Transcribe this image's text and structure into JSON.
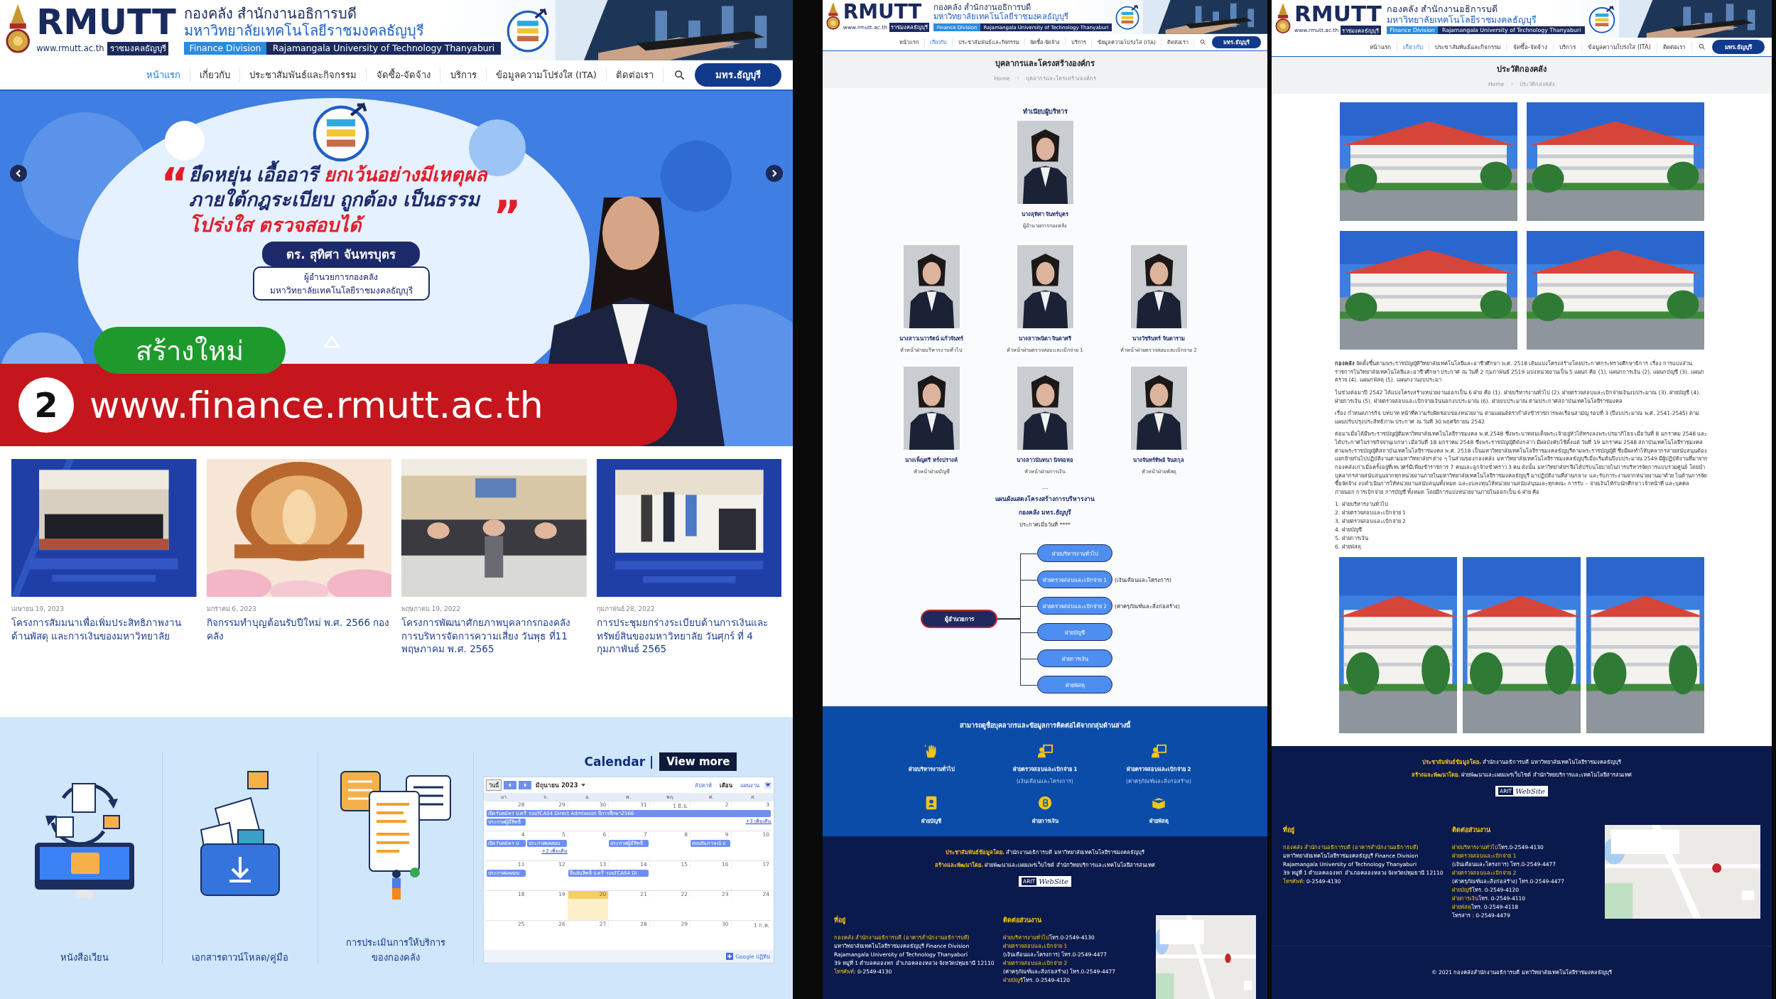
{
  "panels": [
    {
      "kind": "home",
      "header": {
        "logo_text": "RMUTT",
        "url": "www.rmutt.ac.th",
        "tag": "ราชมงคลธัญบุรี",
        "title1": "กองคลัง สำนักงานอธิการบดี",
        "title2": "มหาวิทยาลัยเทคโนโลยีราชมงคลธัญบุรี",
        "division": "Finance Division",
        "university": "Rajamangala University of Technology Thanyaburi"
      },
      "nav": [
        {
          "label": "หน้าแรก",
          "selected": true
        },
        {
          "label": "เกี่ยวกับ",
          "selected": false
        },
        {
          "label": "ประชาสัมพันธ์และกิจกรรม",
          "selected": false
        },
        {
          "label": "จัดซื้อ-จัดจ้าง",
          "selected": false
        },
        {
          "label": "บริการ",
          "selected": false
        },
        {
          "label": "ข้อมูลความโปร่งใส (ITA)",
          "selected": false
        },
        {
          "label": "ติดต่อเรา",
          "selected": false
        }
      ],
      "nav_button": "มทร.ธัญบุรี",
      "hero": {
        "quote_open": "“",
        "quote_close": "”",
        "lines": [
          {
            "parts": [
              {
                "text": "ยืดหยุ่น เอื้ออารี",
                "highlight": false
              },
              {
                "text": "ยกเว้นอย่างมีเหตุผล",
                "highlight": true
              }
            ]
          },
          {
            "parts": [
              {
                "text": "ภายใต้กฎระเบียบ ถูกต้อง เป็นธรรม",
                "highlight": false
              }
            ]
          },
          {
            "parts": [
              {
                "text": "โปร่งใส ตรวจสอบได้",
                "highlight": true
              }
            ]
          }
        ],
        "name": "ดร. สุทิศา จันทรบุตร",
        "role_lines": [
          "ผู้อำนวยการกองคลัง",
          "มหาวิทยาลัยเทคโนโลยีราชมงคลธัญบุรี"
        ]
      },
      "overlay": {
        "tag": "สร้างใหม่",
        "number": "2",
        "url": "www.finance.rmutt.ac.th"
      },
      "news": [
        {
          "date": "เมษายน 19, 2023",
          "title": "โครงการสัมมนาเพื่อเพิ่มประสิทธิภาพงานด้านพัสดุ และการเงินของมหาวิทยาลัย"
        },
        {
          "date": "มกราคม 6, 2023",
          "title": "กิจกรรมทำบุญต้อนรับปีใหม่ พ.ศ. 2566 กองคลัง"
        },
        {
          "date": "พฤษภาคม 19, 2022",
          "title": "โครงการพัฒนาศักยภาพบุคลากรกองคลัง การบริหารจัดการความเสี่ยง วันพุธ ที่11 พฤษภาคม พ.ศ. 2565"
        },
        {
          "date": "กุมภาพันธ์ 28, 2022",
          "title": "การประชุมยกร่างระเบียบด้านการเงินและทรัพย์สินของมหาวิทยาลัย วันศุกร์ ที่ 4 กุมภาพันธ์ 2565"
        }
      ],
      "services": [
        {
          "label": "หนังสือเวียน"
        },
        {
          "label": "เอกสารดาวน์โหลด/คู่มือ"
        },
        {
          "label": "การประเมินการให้บริการของกองคลัง"
        }
      ],
      "calendar": {
        "title": "Calendar |",
        "more": "View more",
        "today_button": "วันนี้",
        "month": "มิถุนายน 2023",
        "views": [
          {
            "label": "สัปดาห์",
            "selected": false
          },
          {
            "label": "เดือน",
            "selected": true
          },
          {
            "label": "แผนงาน",
            "selected": false
          }
        ],
        "weekdays": [
          "อา.",
          "จ.",
          "อ.",
          "พ.",
          "พฤ.",
          "ศ.",
          "ส."
        ],
        "weeks": [
          {
            "days": [
              {
                "label": "28",
                "selected": false,
                "events": [
                  {
                    "text": "เปิดรับสมัคร ป.ตรี รอบTCAS4 Direct Admission ปีการศึกษา2566",
                    "kind": "week"
                  },
                  {
                    "text": "ประกาศผู้มีสิทธิ์",
                    "kind": "single"
                  }
                ]
              },
              {
                "label": "29",
                "selected": false
              },
              {
                "label": "30",
                "selected": false
              },
              {
                "label": "31",
                "selected": false
              },
              {
                "label": "1 มิ.ย.",
                "selected": false
              },
              {
                "label": "2",
                "selected": false
              },
              {
                "label": "3",
                "selected": false,
                "events": [
                  {
                    "text": "+3 เพิ่มเติม",
                    "kind": "more"
                  }
                ]
              }
            ]
          },
          {
            "days": [
              {
                "label": "4",
                "selected": false,
                "events": [
                  {
                    "text": "เปิดรับสมัคร ป",
                    "kind": "single"
                  }
                ]
              },
              {
                "label": "5",
                "selected": false,
                "events": [
                  {
                    "text": "ประกาศผลสอบ",
                    "kind": "single"
                  },
                  {
                    "text": "+2 เพิ่มเติม",
                    "kind": "more"
                  }
                ]
              },
              {
                "label": "6",
                "selected": false
              },
              {
                "label": "7",
                "selected": false,
                "events": [
                  {
                    "text": "ประกาศผู้มีสิทธิ์",
                    "kind": "single"
                  }
                ]
              },
              {
                "label": "8",
                "selected": false
              },
              {
                "label": "9",
                "selected": false,
                "events": [
                  {
                    "text": "สอบสัมภาษณ์ ป",
                    "kind": "single"
                  }
                ]
              },
              {
                "label": "10",
                "selected": false
              }
            ]
          },
          {
            "days": [
              {
                "label": "11",
                "selected": false,
                "events": [
                  {
                    "text": "ประกาศผลสอบ",
                    "kind": "single"
                  }
                ]
              },
              {
                "label": "12",
                "selected": false
              },
              {
                "label": "13",
                "selected": false,
                "events": [
                  {
                    "text": "ยืนยันสิทธิ์ ป.ตรี รอบTCAS4 Di",
                    "kind": "double"
                  }
                ]
              },
              {
                "label": "14",
                "selected": false
              },
              {
                "label": "15",
                "selected": false
              },
              {
                "label": "16",
                "selected": false
              },
              {
                "label": "17",
                "selected": false
              }
            ]
          },
          {
            "days": [
              {
                "label": "18",
                "selected": false
              },
              {
                "label": "19",
                "selected": false
              },
              {
                "label": "20",
                "selected": true
              },
              {
                "label": "21",
                "selected": false
              },
              {
                "label": "22",
                "selected": false
              },
              {
                "label": "23",
                "selected": false
              },
              {
                "label": "24",
                "selected": false
              }
            ]
          },
          {
            "days": [
              {
                "label": "25",
                "selected": false
              },
              {
                "label": "26",
                "selected": false
              },
              {
                "label": "27",
                "selected": false
              },
              {
                "label": "28",
                "selected": false
              },
              {
                "label": "29",
                "selected": false
              },
              {
                "label": "30",
                "selected": false
              },
              {
                "label": "1 ก.ค.",
                "selected": false
              }
            ]
          }
        ],
        "footer": "Google ปฏิทิน"
      }
    },
    {
      "kind": "staff",
      "header": {
        "logo_text": "RMUTT",
        "url": "www.rmutt.ac.th",
        "tag": "ราชมงคลธัญบุรี",
        "title1": "กองคลัง สำนักงานอธิการบดี",
        "title2": "มหาวิทยาลัยเทคโนโลยีราชมงคลธัญบุรี",
        "division": "Finance Division",
        "university": "Rajamangala University of Technology Thanyaburi"
      },
      "nav": [
        {
          "label": "หน้าแรก",
          "selected": false
        },
        {
          "label": "เกี่ยวกับ",
          "selected": true
        },
        {
          "label": "ประชาสัมพันธ์และกิจกรรม",
          "selected": false
        },
        {
          "label": "จัดซื้อ-จัดจ้าง",
          "selected": false
        },
        {
          "label": "บริการ",
          "selected": false
        },
        {
          "label": "ข้อมูลความโปร่งใส (ITA)",
          "selected": false
        },
        {
          "label": "ติดต่อเรา",
          "selected": false
        }
      ],
      "nav_button": "มทร.ธัญบุรี",
      "page_title": "บุคลากรและโครงสร้างองค์กร",
      "breadcrumb": [
        "Home",
        "บุคลากรและโครงสร้างองค์กร"
      ],
      "section_title": "ทำเนียบผู้บริหาร",
      "director": {
        "name": "นางสุทิศา จันทร์บุตร",
        "role": "ผู้อำนวยการกองคลัง"
      },
      "staff": [
        {
          "name": "นางสาวเนาวรัตน์ แก้วจันทร์",
          "role": "หัวหน้าฝ่ายบริหารงานทั่วไป"
        },
        {
          "name": "นางสาวพนิดา จินดาศรี",
          "role": "หัวหน้าฝ่ายตรวจสอบและเบิกจ่าย 1"
        },
        {
          "name": "นางวัชรินทร์ จินดาราม",
          "role": "หัวหน้าฝ่ายตรวจสอบและเบิกจ่าย 2"
        },
        {
          "name": "นางเพ็ญศรี หรั่งปรางค์",
          "role": "หัวหน้าฝ่ายบัญชี"
        },
        {
          "name": "นางสาวนันทนา นิจจอหอ",
          "role": "หัวหน้าฝ่ายการเงิน"
        },
        {
          "name": "นางจันทร์ทิพย์ จินสกุล",
          "role": "หัวหน้าฝ่ายพัสดุ"
        }
      ],
      "ellipsis": "...",
      "chart_title": "แผนผังแสดงโครงสร้างการบริหารงาน",
      "chart_subtitle": "กองคลัง มทร.ธัญบุรี",
      "chart_date": "ประกาศเมื่อวันที่ ****",
      "org": {
        "root": "ผู้อำนวยการ",
        "children": [
          {
            "label": "ฝ่ายบริหารงานทั่วไป"
          },
          {
            "label": "ฝ่ายตรวจสอบและเบิกจ่าย 1",
            "note": "(เงินเดือนและโครงการ)"
          },
          {
            "label": "ฝ่ายตรวจสอบและเบิกจ่าย 2",
            "note": "(ค่าครุภัณฑ์และสิ่งก่อสร้าง)"
          },
          {
            "label": "ฝ่ายบัญชี"
          },
          {
            "label": "ฝ่ายการเงิน"
          },
          {
            "label": "ฝ่ายพัสดุ"
          }
        ]
      },
      "groups_title": "สามารถดูชื่อบุคลากรและข้อมูลการติดต่อได้จากกลุ่มด้านล่างนี้",
      "groups": [
        {
          "label": "ฝ่ายบริหารงานทั่วไป"
        },
        {
          "label": "ฝ่ายตรวจสอบและเบิกจ่าย 1",
          "sub": "(เงินเดือนและโครงการ)"
        },
        {
          "label": "ฝ่ายตรวจสอบและเบิกจ่าย 2",
          "sub": "(ค่าครุภัณฑ์และสิ่งก่อสร้าง)"
        },
        {
          "label": "ฝ่ายบัญชี"
        },
        {
          "label": "ฝ่ายการเงิน"
        },
        {
          "label": "ฝ่ายพัสดุ"
        }
      ],
      "footer": {
        "credits": [
          {
            "label": "ประชาสัมพันธ์ข้อมูลโดย.",
            "text": "สำนักงานอธิการบดี มหาวิทยาลัยเทคโนโลยีราชมงคลธัญบุรี"
          },
          {
            "label": "สร้างและพัฒนาโดย.",
            "text": "ฝ่ายพัฒนาและเผยแพร่เว็บไซต์ สำนักวิทยบริการและเทคโนโลยีสารสนเทศ"
          }
        ],
        "logo_brand": "ARIT",
        "logo_word": "WebSite",
        "address_title": "ที่อยู่",
        "address": [
          {
            "label": "กองคลัง สำนักงานอธิการบดี (อาคารสำนักงานอธิการบดี)"
          },
          {
            "text": "มหาวิทยาลัยเทคโนโลยีราชมงคลธัญบุรี Finance Division"
          },
          {
            "text": "Rajamangala University of Technology Thanyaburi"
          },
          {
            "text": "39 หมู่ที่ 1 ตำบลคลองหก อำเภอคลองหลวง จังหวัดปทุมธานี 12110"
          },
          {
            "label": "โทรศัพท์",
            "text": ": 0-2549-4130"
          }
        ],
        "contact_title": "ติดต่อส่วนงาน",
        "contacts": [
          {
            "label": "ฝ่ายบริหารงานทั่วไป",
            "text": "โทร.0-2549-4130"
          },
          {
            "label": "ฝ่ายตรวจสอบและเบิกจ่าย 1"
          },
          {
            "text": "(เงินเดือนและโครงการ) โทร.0-2549-4477"
          },
          {
            "label": "ฝ่ายตรวจสอบและเบิกจ่าย 2"
          },
          {
            "text": "(ค่าครุภัณฑ์และสิ่งก่อสร้าง) โทร.0-2549-4477"
          },
          {
            "label": "ฝ่ายบัญชี",
            "text": "โทร. 0-2549-4120"
          }
        ]
      }
    },
    {
      "kind": "history",
      "header": {
        "logo_text": "RMUTT",
        "url": "www.rmutt.ac.th",
        "tag": "ราชมงคลธัญบุรี",
        "title1": "กองคลัง สำนักงานอธิการบดี",
        "title2": "มหาวิทยาลัยเทคโนโลยีราชมงคลธัญบุรี",
        "division": "Finance Division",
        "university": "Rajamangala University of Technology Thanyaburi"
      },
      "nav": [
        {
          "label": "หน้าแรก",
          "selected": false
        },
        {
          "label": "เกี่ยวกับ",
          "selected": true
        },
        {
          "label": "ประชาสัมพันธ์และกิจกรรม",
          "selected": false
        },
        {
          "label": "จัดซื้อ-จัดจ้าง",
          "selected": false
        },
        {
          "label": "บริการ",
          "selected": false
        },
        {
          "label": "ข้อมูลความโปร่งใส (ITA)",
          "selected": false
        },
        {
          "label": "ติดต่อเรา",
          "selected": false
        }
      ],
      "nav_button": "มทร.ธัญบุรี",
      "page_title": "ประวัติกองคลัง",
      "breadcrumb": [
        "Home",
        "ประวัติกองคลัง"
      ],
      "paragraphs": [
        "**กองคลัง** จัดตั้งขึ้นตามพระราชบัญญัติวิทยาลัยเทคโนโลยีและอาชีวศึกษา พ.ศ. 2518 เดิมแบ่งโครงสร้างโดยประกาศกระทรวงศึกษาธิการ เรื่อง การแบ่งส่วนราชการในวิทยาลัยเทคโนโลยีและอาชีวศึกษา ประกาศ ณ วันที่ 2 กุมภาพันธ์ 2519 แบ่งหน่วยงานเป็น 5 แผนก คือ (1). แผนกการเงิน (2). แผนกบัญชี (3). แผนกตรวจ (4). แผนกพัสดุ (5). แผนกงานงบประมา",
        "ในช่วงต่อมาปี 2542 ได้แบ่งโครงสร้างหน่วยงานออกเป็น 6 ฝ่าย คือ (1). ฝ่ายบริหารงานทั่วไป (2). ฝ่ายตรวจสอบและเบิกจ่ายเงินงบประมาณ (3). ฝ่ายบัญชี (4). ฝ่ายการเงิน (5). ฝ่ายตรวจสอบและเบิกจ่ายเงินนอกงบประมาณ (6). ฝ่ายงบประมาณ ตามประกาศสถาบันเทคโนโลยีราชมงคล",
        "เรื่อง กำหนดภารกิจ บทบาท หน้าที่ความรับผิดชอบของหน่วยงาน ตามแผนอัตรากำลังข้าราชการพลเรือนสามัญ รอบที่ 3 (ปีงบประมาณ พ.ศ. 2541-2545) ตามแผนปรับปรุงประสิทธิภาพ ประกาศ ณ วันที่ 30 พฤศจิกายน 2542",
        "ต่อมาเมื่อได้มีพระราชบัญญัติมหาวิทยาลัยเทคโนโลยีราชมงคล พ.ศ.2548 ซึ่งพระบาทสมเด็จพระเจ้าอยู่หัวได้ทรงลงพระปรมาภิไธย เมื่อวันที่ 8 มกราคม 2548 และได้ประกาศในราชกิจจานุเบกษา เมื่อวันที่ 18 มกราคม 2548 ซึ่งพระราชบัญญัติดังกล่าว มีผลบังคับใช้ตั้งแต่ วันที่ 19 มกราคม 2548 สถาบันเทคโนโลยีราชมงคล ตามพระราชบัญญัติสถาบันเทคโนโลยีราชมงคล พ.ศ. 2518 เป็นมหาวิทยาลัยเทคโนโลยีราชมงคลธัญบุรีตามพระราชบัญญัติ ซึ่งมีผลทำให้บุคลากรสายสนับสนุนต้องแยกย้ายกันไปปฏิบัติงานตามมหาวิทยาลัยฯ ต่าง ๆ ในส่วนของกองคลัง มหาวิทยาลัยเทคโนโลยีราชมงคลธัญบุรีเมื่อเริ่มต้นปีงบประมาณ 2549 มีผู้ปฏิบัติงานที่มาจากกองคลังเก่าเมื่อครั้งอยู่ที่เทเวศร์มีเพียงข้าราชการ 7 คนและลูกจ้างชั่วคราว 3 คน ดังนั้น มหาวิทยาลัยฯ จึงได้ปรับนโยบายในการบริหารจัดการแบบรวมศูนย์ โดยนำบุคลากรสายสนับสนุนจากทุกหน่วยงานภายในมหาวิทยาลัยเทคโนโลยีราชมงคลธัญบุรี มาปฏิบัติงานที่ส่วนกลาง และรับภาระงานจากหน่วยงานมาด้วย ในด้านการจัดซื้อจัดจ้าง งบดำเนินการให้หน่วยงานสนับสนุนทั้งหมด และงบลงทุนให้หน่วยงานสนับสนุนและทุกคณะ การรับ – จ่ายเงินให้กับนักศึกษา เจ้าหน้าที่ และบุคคลภายนอก การเบิกจ่าย การบัญชี ทั้งหมด โดยมีการแบ่งหน่วยงานภายในออกเป็น 6 ฝ่าย คือ"
      ],
      "list": [
        "1. ฝ่ายบริหารงานทั่วไป",
        "2. ฝ่ายตรวจสอบและเบิกจ่าย 1",
        "3. ฝ่ายตรวจสอบและเบิกจ่าย 2",
        "4. ฝ่ายบัญชี",
        "5. ฝ่ายการเงิน",
        "6. ฝ่ายพัสดุ"
      ],
      "footer": {
        "credits": [
          {
            "label": "ประชาสัมพันธ์ข้อมูลโดย.",
            "text": "สำนักงานอธิการบดี มหาวิทยาลัยเทคโนโลยีราชมงคลธัญบุรี"
          },
          {
            "label": "สร้างและพัฒนาโดย.",
            "text": "ฝ่ายพัฒนาและเผยแพร่เว็บไซต์ สำนักวิทยบริการและเทคโนโลยีสารสนเทศ"
          }
        ],
        "logo_brand": "ARIT",
        "logo_word": "WebSite",
        "address_title": "ที่อยู่",
        "address": [
          {
            "label": "กองคลัง สำนักงานอธิการบดี (อาคารสำนักงานอธิการบดี)"
          },
          {
            "text": "มหาวิทยาลัยเทคโนโลยีราชมงคลธัญบุรี Finance Division"
          },
          {
            "text": "Rajamangala University of Technology Thanyaburi"
          },
          {
            "text": "39 หมู่ที่ 1 ตำบลคลองหก อำเภอคลองหลวง จังหวัดปทุมธานี 12110"
          },
          {
            "label": "โทรศัพท์",
            "text": ": 0-2549-4130"
          }
        ],
        "contact_title": "ติดต่อส่วนงาน",
        "contacts": [
          {
            "label": "ฝ่ายบริหารงานทั่วไป",
            "text": "โทร.0-2549-4130"
          },
          {
            "label": "ฝ่ายตรวจสอบและเบิกจ่าย 1"
          },
          {
            "text": "(เงินเดือนและโครงการ) โทร.0-2549-4477"
          },
          {
            "label": "ฝ่ายตรวจสอบและเบิกจ่าย 2"
          },
          {
            "text": "(ค่าครุภัณฑ์และสิ่งก่อสร้าง) โทร.0-2549-4477"
          },
          {
            "label": "ฝ่ายบัญชี",
            "text": "โทร. 0-2549-4120"
          },
          {
            "label": "ฝ่ายการเงิน",
            "text": "โทร. 0-2549-4110"
          },
          {
            "label": "ฝ่ายพัสดุ",
            "text": "โทร. 0-2549-4118"
          },
          {
            "text": "โทรสาร : 0-2549-4479"
          }
        ],
        "copyright": "© 2021 กองคลังสำนักงานอธิการบดี มหาวิทยาลัยเทคโนโลยีราชมงคลธัญบุรี"
      }
    }
  ]
}
